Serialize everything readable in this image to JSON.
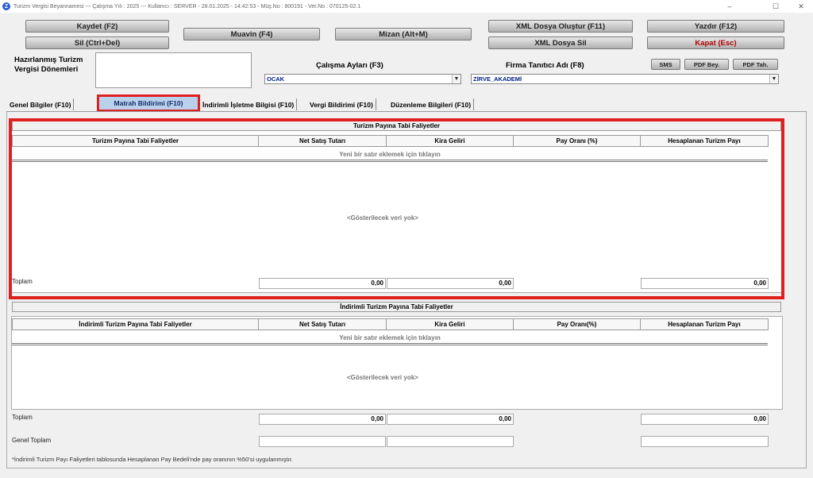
{
  "window": {
    "title": "Turizm Vergisi Beyannamesi  ---  Çalışma Yılı : 2025  ---  Kullanıcı : SERVER - 28.01.2025 - 14:42:53 - Müş.No : 800191 - Ver.No : 070125-02.1",
    "minimize": "–",
    "maximize": "☐",
    "close": "✕",
    "app_icon": "Z"
  },
  "toolbar": {
    "kaydet": "Kaydet (F2)",
    "sil": "Sil (Ctrl+Del)",
    "muavin": "Muavin (F4)",
    "mizan": "Mizan (Alt+M)",
    "xml_olustur": "XML Dosya Oluştur (F11)",
    "xml_sil": "XML Dosya Sil",
    "yazdir": "Yazdır (F12)",
    "kapat": "Kapat (Esc)",
    "sms": "SMS",
    "pdf_bey": "PDF Bey.",
    "pdf_tah": "PDF Tah."
  },
  "form": {
    "hazirlanmis_label": "Hazırlanmış Turizm Vergisi Dönemleri",
    "calisma_aylari_label": "Çalışma Ayları (F3)",
    "calisma_aylari_value": "OCAK",
    "firma_label": "Firma Tanıtıcı Adı (F8)",
    "firma_value": "ZİRVE_AKADEMİ"
  },
  "tabs": [
    {
      "label": "Genel Bilgiler (F10)"
    },
    {
      "label": "Matrah Bildirimi (F10)"
    },
    {
      "label": "İndirimli İşletme Bilgisi (F10)"
    },
    {
      "label": "Vergi Bildirimi (F10)"
    },
    {
      "label": "Düzenleme Bilgileri (F10)"
    }
  ],
  "section1": {
    "title": "Turizm Payına Tabi Faliyetler",
    "columns": [
      "Turizm Payına Tabi Faliyetler",
      "Net Satış Tutarı",
      "Kira Geliri",
      "Pay Oranı (%)",
      "Hesaplanan Turizm Payı"
    ],
    "add_row": "Yeni bir satır eklemek için tıklayın",
    "empty": "<Gösterilecek veri yok>",
    "total_label": "Toplam",
    "total_net": "0,00",
    "total_kira": "0,00",
    "total_hesap": "0,00"
  },
  "section2": {
    "title": "İndirimli Turizm Payına Tabi Faliyetler",
    "columns": [
      "İndirimli Turizm Payına Tabi Faliyetler",
      "Net Satış Tutarı",
      "Kira Geliri",
      "Pay Oranı(%)",
      "Hesaplanan Turizm Payı"
    ],
    "add_row": "Yeni bir satır eklemek için tıklayın",
    "empty": "<Gösterilecek veri yok>",
    "total_label": "Toplam",
    "total_net": "0,00",
    "total_kira": "0,00",
    "total_hesap": "0,00"
  },
  "genel_toplam_label": "Genel Toplam",
  "footnote": "*İndirimli Turizm Payı Faliyetleri tablosunda Hesaplanan Pay Bedeli'nde pay oranının %50'si uygulanmıştır.",
  "colors": {
    "highlight": "#e02020",
    "active_tab_bg": "#b9d1ea",
    "kapat_text": "#b00000"
  }
}
